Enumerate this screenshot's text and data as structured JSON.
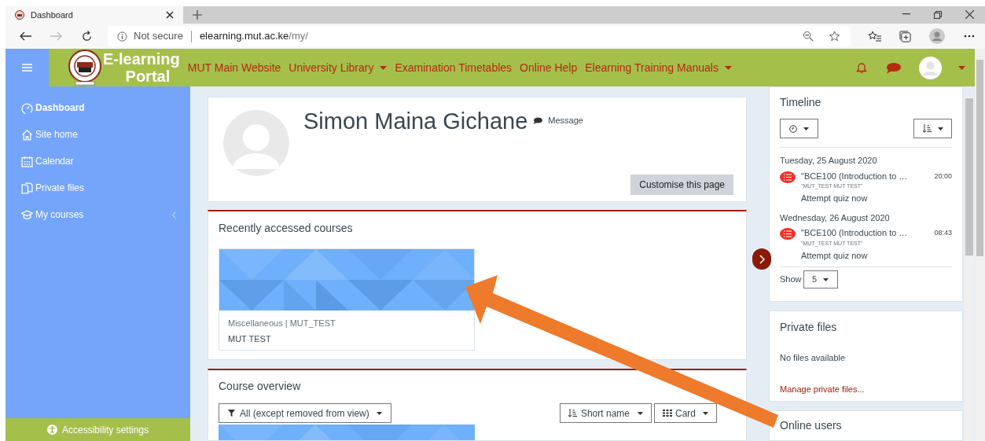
{
  "browser": {
    "tab_title": "Dashboard",
    "security": "Not secure",
    "url_host": "elearning.mut.ac.ke",
    "url_path": "/my/"
  },
  "navbar": {
    "brand_lines": [
      "E-learning",
      "Portal"
    ],
    "links": [
      {
        "label": "MUT Main Website",
        "dropdown": false
      },
      {
        "label": "University Library",
        "dropdown": true
      },
      {
        "label": "Examination Timetables",
        "dropdown": false
      },
      {
        "label": "Online Help",
        "dropdown": false
      },
      {
        "label": "Elearning Training Manuals",
        "dropdown": true
      }
    ]
  },
  "sidebar": {
    "items": [
      {
        "label": "Dashboard",
        "selected": true,
        "submenu": false
      },
      {
        "label": "Site home",
        "selected": false,
        "submenu": false
      },
      {
        "label": "Calendar",
        "selected": false,
        "submenu": false
      },
      {
        "label": "Private files",
        "selected": false,
        "submenu": false
      },
      {
        "label": "My courses",
        "selected": false,
        "submenu": true
      }
    ],
    "footer": "Accessibility settings"
  },
  "profile": {
    "name": "Simon Maina Gichane",
    "message": "Message",
    "customise_button": "Customise this page"
  },
  "recent": {
    "title": "Recently accessed courses",
    "courses": [
      {
        "category": "Miscellaneous | MUT_TEST",
        "name": "MUT TEST"
      }
    ]
  },
  "overview": {
    "title": "Course overview",
    "filter": "All (except removed from view)",
    "sort": "Short name",
    "view": "Card"
  },
  "timeline": {
    "title": "Timeline",
    "groups": [
      {
        "date": "Tuesday, 25 August 2020",
        "events": [
          {
            "title": "\"BCE100 (Introduction to …",
            "time": "20:00",
            "course": "\"MUT_TEST MUT TEST\"",
            "action": "Attempt quiz now"
          }
        ]
      },
      {
        "date": "Wednesday, 26 August 2020",
        "events": [
          {
            "title": "\"BCE100 (Introduction to …",
            "time": "08:43",
            "course": "\"MUT_TEST MUT TEST\"",
            "action": "Attempt quiz now"
          }
        ]
      }
    ],
    "show_label": "Show",
    "show_value": "5"
  },
  "private_files": {
    "title": "Private files",
    "empty": "No files available",
    "link": "Manage private files..."
  },
  "online_users": {
    "title": "Online users"
  }
}
